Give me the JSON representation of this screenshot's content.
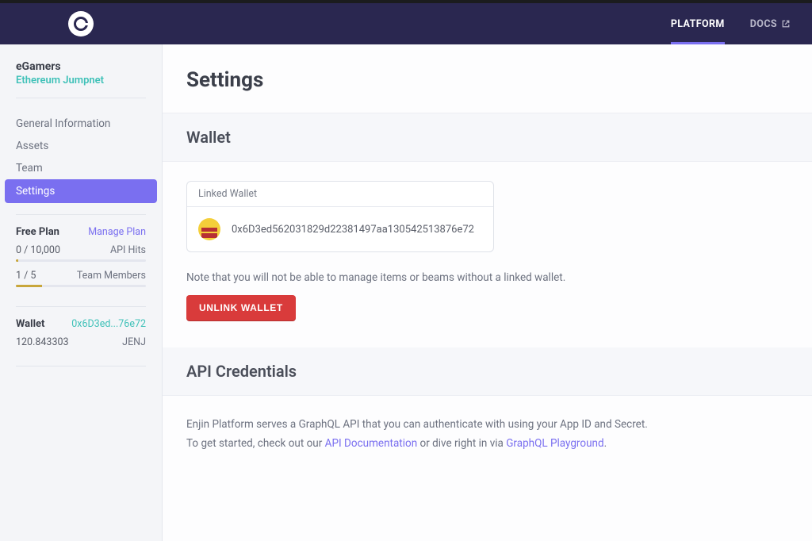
{
  "topnav": {
    "platform": "PLATFORM",
    "docs": "DOCS"
  },
  "sidebar": {
    "project_name": "eGamers",
    "network": "Ethereum Jumpnet",
    "nav": {
      "general": "General Information",
      "assets": "Assets",
      "team": "Team",
      "settings": "Settings"
    },
    "plan": {
      "title": "Free Plan",
      "manage": "Manage Plan",
      "api_hits_label": "API Hits",
      "api_hits_value": "0 / 10,000",
      "team_label": "Team Members",
      "team_value": "1 / 5"
    },
    "wallet": {
      "title": "Wallet",
      "short_addr": "0x6D3ed...76e72",
      "balance": "120.843303",
      "token": "JENJ"
    }
  },
  "page": {
    "title": "Settings",
    "wallet_section": {
      "title": "Wallet",
      "card_title": "Linked Wallet",
      "full_addr": "0x6D3ed562031829d22381497aa130542513876e72",
      "note": "Note that you will not be able to manage items or beams without a linked wallet.",
      "unlink_btn": "UNLINK WALLET"
    },
    "api_section": {
      "title": "API Credentials",
      "line1": "Enjin Platform serves a GraphQL API that you can authenticate with using your App ID and Secret.",
      "line2_a": "To get started, check out our ",
      "line2_link1": "API Documentation",
      "line2_b": " or dive right in via ",
      "line2_link2": "GraphQL Playground",
      "line2_c": "."
    }
  }
}
